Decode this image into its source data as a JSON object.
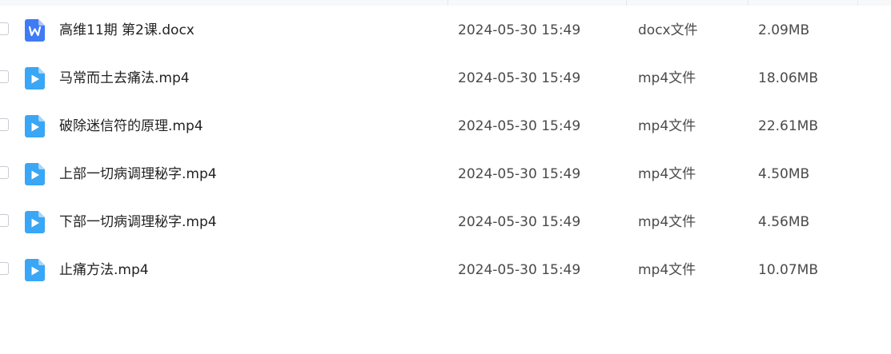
{
  "files": [
    {
      "name": "高维11期  第2课.docx",
      "date": "2024-05-30 15:49",
      "type": "docx文件",
      "size": "2.09MB",
      "icon": "word-doc-icon"
    },
    {
      "name": "马常而土去痛法.mp4",
      "date": "2024-05-30 15:49",
      "type": "mp4文件",
      "size": "18.06MB",
      "icon": "video-file-icon"
    },
    {
      "name": "破除迷信符的原理.mp4",
      "date": "2024-05-30 15:49",
      "type": "mp4文件",
      "size": "22.61MB",
      "icon": "video-file-icon"
    },
    {
      "name": "上部一切病调理秘字.mp4",
      "date": "2024-05-30 15:49",
      "type": "mp4文件",
      "size": "4.50MB",
      "icon": "video-file-icon"
    },
    {
      "name": "下部一切病调理秘字.mp4",
      "date": "2024-05-30 15:49",
      "type": "mp4文件",
      "size": "4.56MB",
      "icon": "video-file-icon"
    },
    {
      "name": "止痛方法.mp4",
      "date": "2024-05-30 15:49",
      "type": "mp4文件",
      "size": "10.07MB",
      "icon": "video-file-icon"
    }
  ],
  "colors": {
    "doc_icon": "#3f7bf5",
    "video_icon": "#3aa6f6",
    "header_bg": "#f7f8fa"
  }
}
